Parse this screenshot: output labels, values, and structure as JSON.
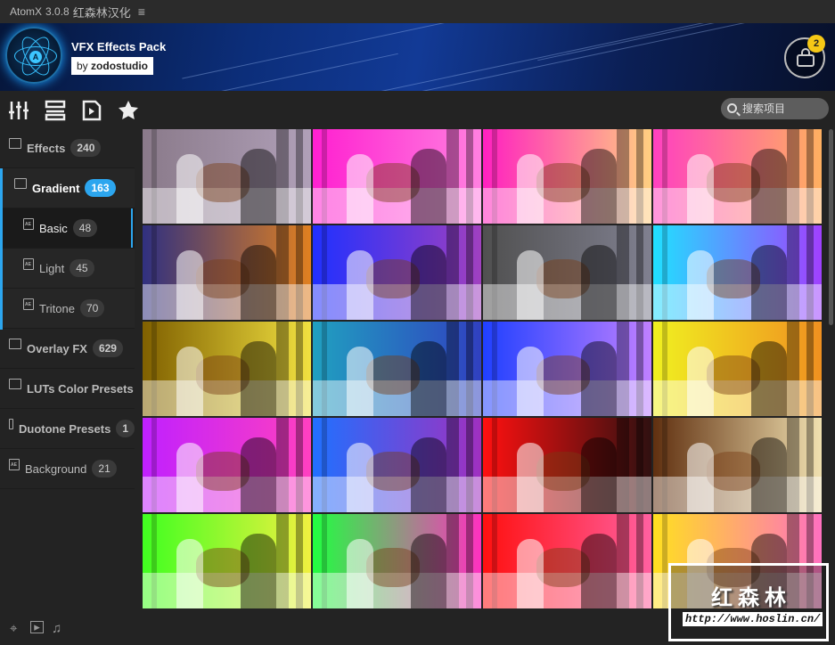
{
  "titlebar": {
    "app": "AtomX",
    "version": "3.0.8",
    "locale": "红森林汉化",
    "menu_icon": "hamburger-icon"
  },
  "banner": {
    "title": "VFX Effects Pack",
    "by": "by",
    "author": "zodostudio",
    "logo_letter": "A",
    "cart_count": "2"
  },
  "toolbar": {
    "icons": [
      "sliders-icon",
      "list-icon",
      "video-file-icon",
      "star-icon"
    ],
    "search_placeholder": "搜索项目"
  },
  "sidebar": {
    "items": [
      {
        "label": "Effects",
        "count": "240"
      },
      {
        "label": "Gradient",
        "count": "163"
      },
      {
        "label": "Basic",
        "count": "48"
      },
      {
        "label": "Light",
        "count": "45"
      },
      {
        "label": "Tritone",
        "count": "70"
      },
      {
        "label": "Overlay FX",
        "count": "629"
      },
      {
        "label": "LUTs Color Presets",
        "count": ""
      },
      {
        "label": "Duotone Presets",
        "count": "1"
      },
      {
        "label": "Background",
        "count": "21"
      }
    ]
  },
  "colors": {
    "accent": "#2ca6ef",
    "badge": "#f5c816"
  },
  "tiles": [
    [
      "#8a7a8a",
      "#b0a0b8"
    ],
    [
      "#ff20d0",
      "#ff80e0"
    ],
    [
      "#ff20c0",
      "#ffd080"
    ],
    [
      "#ff40c0",
      "#ffb060"
    ],
    [
      "#303080",
      "#e08020"
    ],
    [
      "#2030ff",
      "#a040c0"
    ],
    [
      "#505050",
      "#808090"
    ],
    [
      "#20e0ff",
      "#a040ff"
    ],
    [
      "#806000",
      "#f0e040"
    ],
    [
      "#20a0c0",
      "#3040c0"
    ],
    [
      "#2040ff",
      "#c080ff"
    ],
    [
      "#f0f020",
      "#f09020"
    ],
    [
      "#c020ff",
      "#ff40c0"
    ],
    [
      "#2070ff",
      "#a030c0"
    ],
    [
      "#ff1010",
      "#301010"
    ],
    [
      "#603010",
      "#f0e0b0"
    ],
    [
      "#40ff20",
      "#f0f040"
    ],
    [
      "#20ff40",
      "#ff30c0"
    ],
    [
      "#ff1010",
      "#ff60a0"
    ],
    [
      "#ffe020",
      "#ff70c0"
    ]
  ],
  "watermark": {
    "name": "红森林",
    "url": "http://www.hoslin.cn/"
  }
}
